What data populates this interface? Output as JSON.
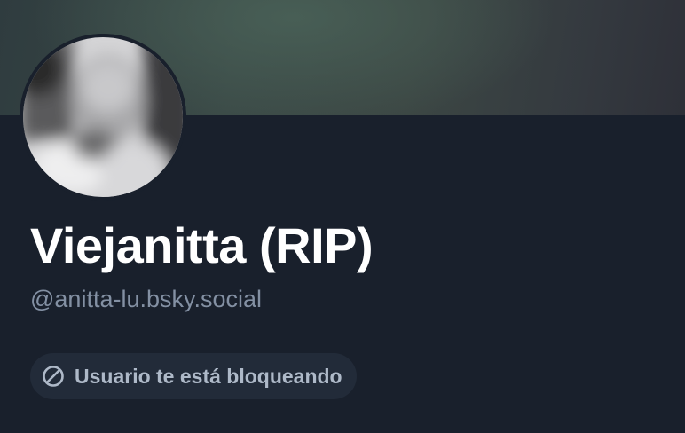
{
  "profile": {
    "display_name": "Viejanitta (RIP)",
    "handle": "@anitta-lu.bsky.social",
    "blocked_notice": "Usuario te está bloqueando"
  },
  "icons": {
    "blocked": "block-icon"
  },
  "colors": {
    "background": "#19202c",
    "display_name": "#ffffff",
    "handle": "#8390a3",
    "pill_background": "#222b39",
    "pill_text": "#aeb9c8"
  }
}
